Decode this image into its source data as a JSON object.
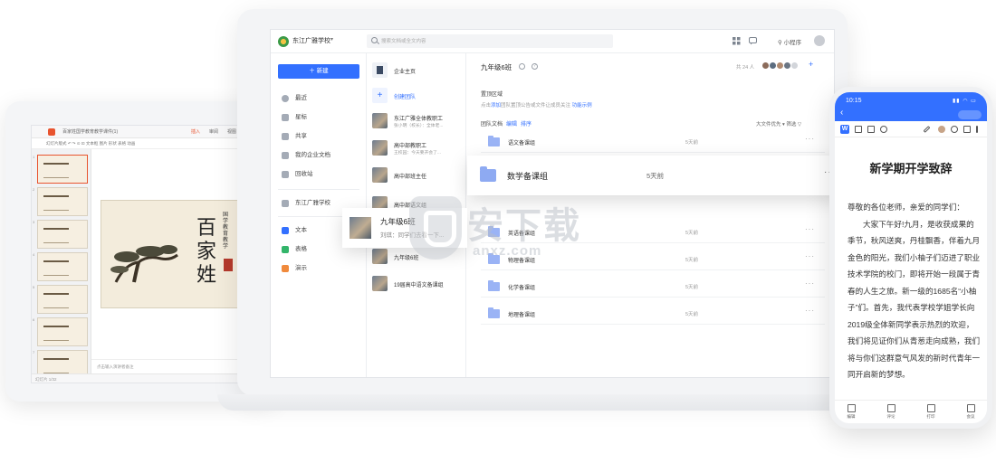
{
  "presentation": {
    "window_title": "百家姓国学教育教学课件(1)",
    "tabs": [
      "插入",
      "审阅",
      "视图"
    ],
    "toolbar_text": "幻灯片版式  ↶ ↷  ⊙ ⊡  文本框  图片  形状  表格  动画",
    "thumb_numbers": [
      "1",
      "2",
      "3",
      "4",
      "5",
      "6",
      "7"
    ],
    "slide_main": "百家姓",
    "slide_sub": "国学教育教学",
    "notes_placeholder": "点击输入演讲者备注",
    "status": "幻灯片 1/32"
  },
  "topbar": {
    "org_name": "东江广雅学校",
    "search_placeholder": "搜索文档或全文内容",
    "mini_program": "小程序"
  },
  "sidebar": {
    "new_button": "＋ 新建",
    "items": [
      {
        "label": "最近"
      },
      {
        "label": "星标"
      },
      {
        "label": "共享"
      },
      {
        "label": "我的企业文档"
      },
      {
        "label": "回收站"
      }
    ],
    "org_item": "东江广雅学校",
    "create_items": [
      {
        "label": "文本"
      },
      {
        "label": "表格"
      },
      {
        "label": "演示"
      }
    ]
  },
  "teams": {
    "items": [
      {
        "title": "企业主页",
        "sub": ""
      },
      {
        "title": "创建团队",
        "sub": ""
      },
      {
        "title": "东江广雅全体教职工",
        "sub": "张小明（校长）：全体老..."
      },
      {
        "title": "高中部教职工",
        "sub": "王校园：今天要开会了..."
      },
      {
        "title": "高中部班主任",
        "sub": ""
      },
      {
        "title": "高中部语文组",
        "sub": ""
      },
      {
        "title": "九年级6班",
        "sub": ""
      },
      {
        "title": "19届高中语文备课组",
        "sub": ""
      }
    ]
  },
  "main": {
    "title": "九年级6班",
    "member_count": "共 24 人",
    "pinned_title": "置顶区域",
    "pinned_hint_prefix": "点击",
    "pinned_hint_link": "添加",
    "pinned_hint_mid": "团队置顶公告或文件让成员关注",
    "pinned_hint_link2": "功能示例",
    "team_docs": "团队文档",
    "team_docs_edit": "编辑",
    "team_docs_sort": "排序",
    "sort_label": "大文件优先 ▾    筛选 ▽",
    "rows": [
      {
        "name": "语文备课组",
        "time": "5天前"
      },
      {
        "name": "数学备课组",
        "time": "5天前"
      },
      {
        "name": "英语备课组",
        "time": "5天前"
      },
      {
        "name": "物理备课组",
        "time": "5天前"
      },
      {
        "name": "化学备课组",
        "time": "5天前"
      },
      {
        "name": "地理备课组",
        "time": "5天前"
      }
    ]
  },
  "drag_card": {
    "name": "数学备课组",
    "time": "5天前",
    "more": "···"
  },
  "float_card": {
    "name": "九年级6班",
    "sub": "刘琪：同学们去看一下..."
  },
  "watermark": {
    "text": "安下载",
    "url": "anxz.com"
  },
  "phone": {
    "time": "10:15",
    "title": "新学期开学致辞",
    "greeting": "尊敬的各位老师，亲爱的同学们：",
    "body": "大家下午好!九月，是收获成果的季节，秋风送爽，丹桂飘香，伴着九月金色的阳光，我们小柚子们迈进了职业技术学院的校门，即将开始一段属于青春的人生之旅。新一级的1685名“小柚子”们。首先，我代表学校学姐学长向2019级全体新同学表示热烈的欢迎，我们将见证你们从青葱走向成熟，我们将与你们这群意气风发的新时代青年一同开启新的梦想。",
    "bottom": [
      "编辑",
      "评论",
      "打印",
      "会议"
    ]
  },
  "colors": {
    "accent": "#3370ff",
    "ppt_brand": "#e8542f"
  }
}
